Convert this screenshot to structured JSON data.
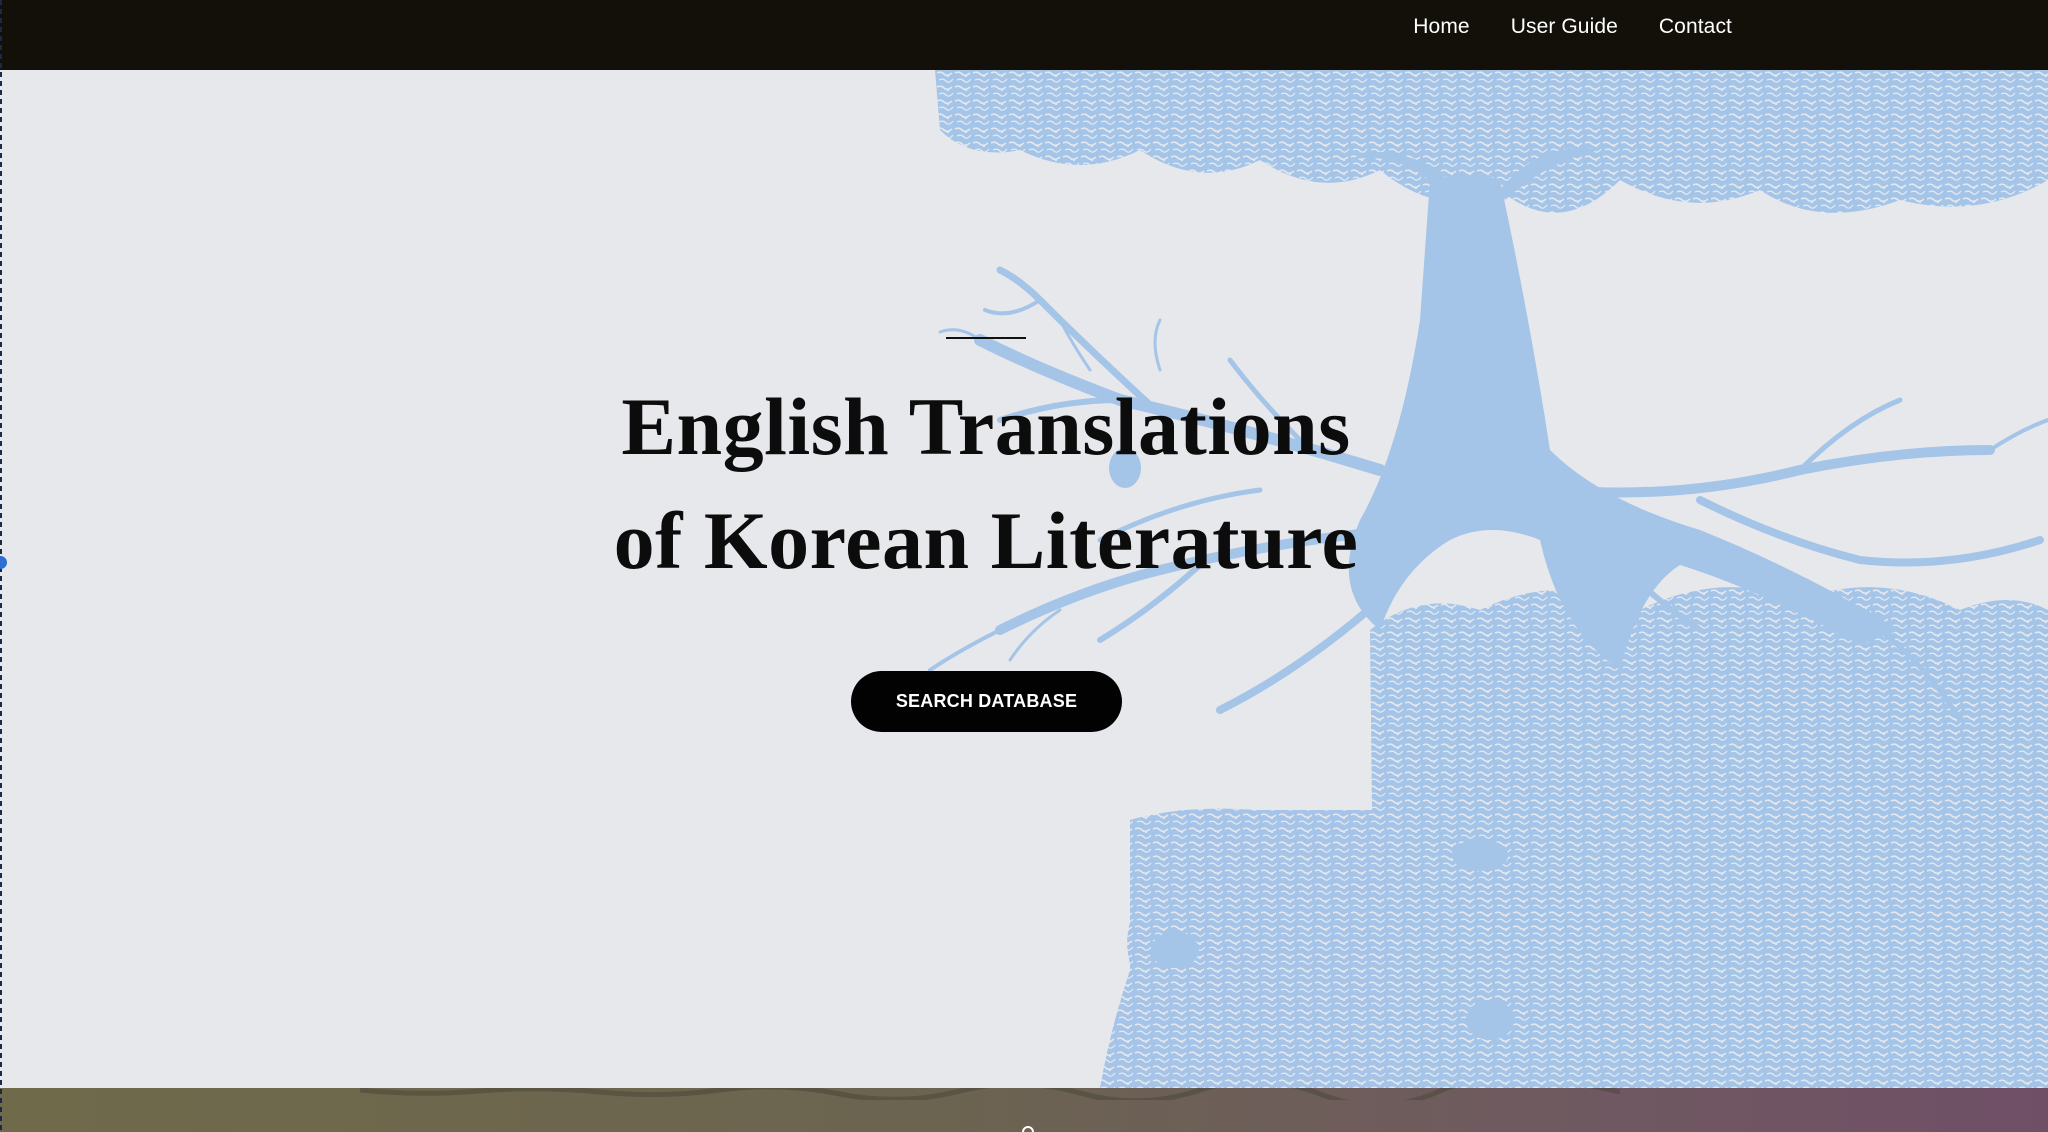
{
  "nav": {
    "items": [
      {
        "label": "Home"
      },
      {
        "label": "User Guide"
      },
      {
        "label": "Contact"
      }
    ]
  },
  "hero": {
    "title_line1": "English Translations",
    "title_line2": "of Korean Literature",
    "cta_label": "SEARCH DATABASE",
    "background_art": "tree-illustration",
    "colors": {
      "background": "#e7e8ec",
      "tree": "#a4c4e8",
      "text": "#0c0c0c",
      "button": "#020202"
    }
  },
  "topbar": {
    "background": "#131009"
  },
  "next_section": {
    "colors": [
      "#6f6a4a",
      "#6f4f66"
    ]
  }
}
